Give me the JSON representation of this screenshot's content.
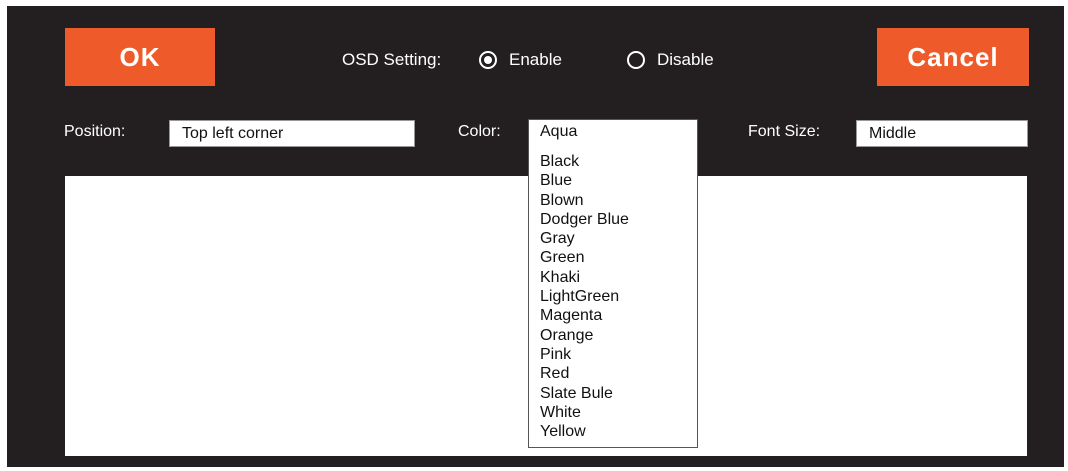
{
  "buttons": {
    "ok_label": "OK",
    "cancel_label": "Cancel"
  },
  "osd": {
    "label": "OSD Setting:",
    "options": [
      {
        "label": "Enable",
        "selected": true
      },
      {
        "label": "Disable",
        "selected": false
      }
    ]
  },
  "position": {
    "label": "Position:",
    "value": "Top left corner"
  },
  "color": {
    "label": "Color:",
    "selected": "Aqua",
    "options": [
      "Black",
      "Blue",
      "Blown",
      "Dodger Blue",
      "Gray",
      "Green",
      "Khaki",
      "LightGreen",
      "Magenta",
      "Orange",
      "Pink",
      "Red",
      "Slate Bule",
      "White",
      "Yellow"
    ]
  },
  "font_size": {
    "label": "Font Size:",
    "value": "Middle"
  },
  "colors": {
    "panel_bg": "#231f20",
    "button_bg": "#ee5a29",
    "text": "#ffffff"
  }
}
